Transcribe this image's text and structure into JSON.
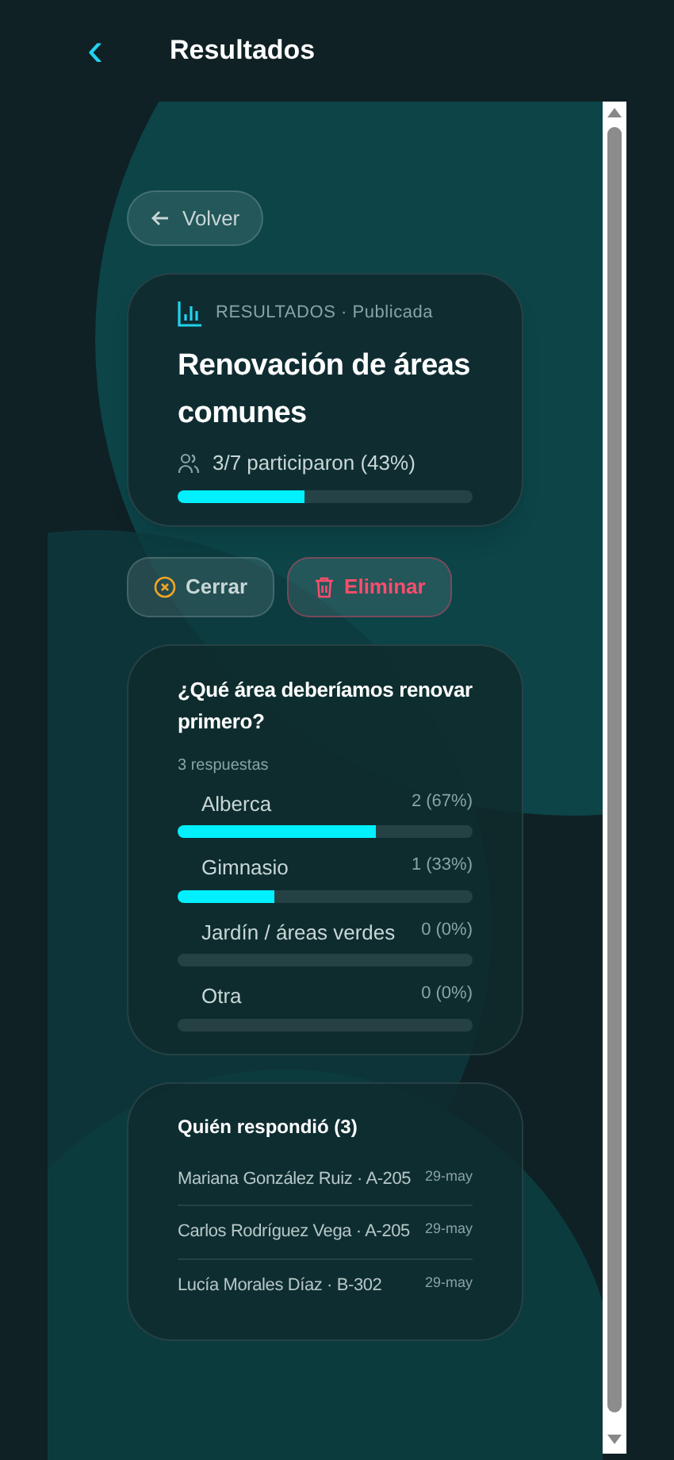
{
  "header": {
    "back_icon": "‹",
    "title": "Resultados"
  },
  "back_button": {
    "label": "Volver"
  },
  "summary": {
    "eyebrow": "RESULTADOS · Publicada",
    "title": "Renovación de áreas comunes",
    "participation": "3/7 participaron (43%)",
    "level": 0.43
  },
  "actions": [
    {
      "label": "Cerrar",
      "kind": "close"
    },
    {
      "label": "Eliminar",
      "kind": "delete"
    }
  ],
  "question": {
    "title": "¿Qué área deberíamos renovar primero?",
    "count": "3 respuestas",
    "options": [
      {
        "label": "Alberca",
        "result": "2 (67%)",
        "level": 0.67
      },
      {
        "label": "Gimnasio",
        "result": "1 (33%)",
        "level": 0.33
      },
      {
        "label": "Jardín / áreas verdes",
        "result": "0 (0%)",
        "level": 0
      },
      {
        "label": "Otra",
        "result": "0 (0%)",
        "level": 0
      }
    ]
  },
  "respondents": {
    "title": "Quién respondió (3)",
    "items": [
      {
        "name": "Mariana González Ruiz · A-205",
        "date": "29-may"
      },
      {
        "name": "Carlos Rodríguez Vega · A-205",
        "date": "29-may"
      },
      {
        "name": "Lucía Morales Díaz · B-302",
        "date": "29-may"
      }
    ]
  }
}
